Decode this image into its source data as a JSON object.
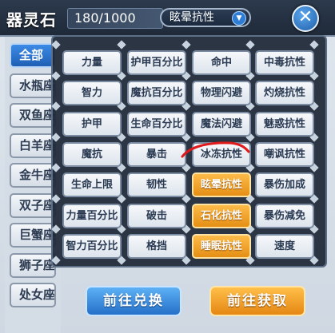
{
  "header": {
    "title": "器灵石",
    "count": "180/1000",
    "filter_selected": "眩晕抗性",
    "close_label": "✕"
  },
  "categories": [
    {
      "label": "全部"
    },
    {
      "label": "水瓶座"
    },
    {
      "label": "双鱼座"
    },
    {
      "label": "白羊座"
    },
    {
      "label": "金牛座"
    },
    {
      "label": "双子座"
    },
    {
      "label": "巨蟹座"
    },
    {
      "label": "狮子座"
    },
    {
      "label": "处女座"
    }
  ],
  "attributes": [
    [
      "力量",
      "护甲百分比",
      "命中",
      "中毒抗性"
    ],
    [
      "智力",
      "魔抗百分比",
      "物理闪避",
      "灼烧抗性"
    ],
    [
      "护甲",
      "生命百分比",
      "魔法闪避",
      "魅惑抗性"
    ],
    [
      "魔抗",
      "暴击",
      "冰冻抗性",
      "嘲讽抗性"
    ],
    [
      "生命上限",
      "韧性",
      "眩晕抗性",
      "暴伤加成"
    ],
    [
      "力量百分比",
      "破击",
      "石化抗性",
      "暴伤减免"
    ],
    [
      "智力百分比",
      "格挡",
      "睡眠抗性",
      "速度"
    ]
  ],
  "highlighted_attributes": [
    "眩晕抗性",
    "石化抗性",
    "睡眠抗性"
  ],
  "footer": {
    "exchange_label": "前往兑换",
    "obtain_label": "前往获取"
  },
  "colors": {
    "accent_blue": "#2e7cd3",
    "accent_orange": "#f0a02a",
    "annotation_red": "#e0191b"
  },
  "icons": {
    "dropdown": "chevron-down-icon",
    "close": "close-icon"
  }
}
